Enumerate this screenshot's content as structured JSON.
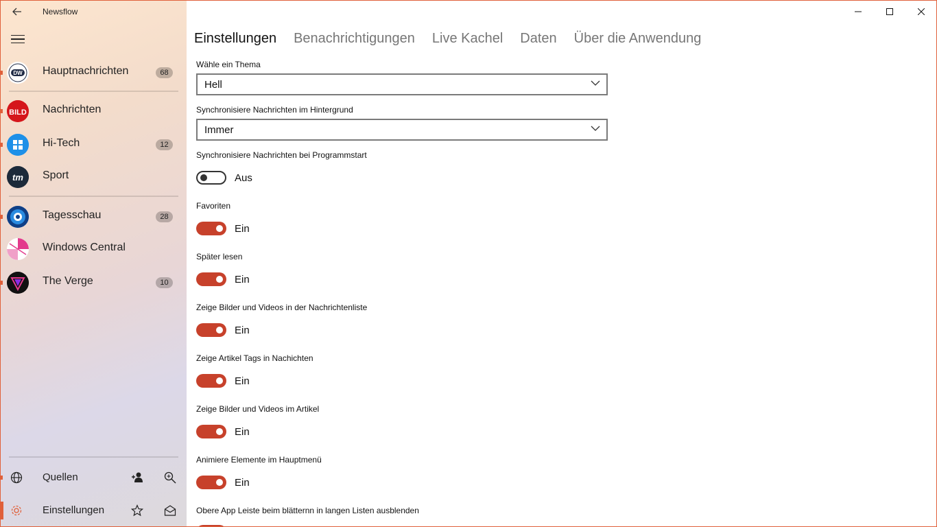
{
  "window": {
    "title": "Newsflow"
  },
  "sidebar": {
    "feeds": [
      {
        "label": "Hauptnachrichten",
        "badge": "68",
        "icon": "dw-logo-icon",
        "icon_text": "DW",
        "color": "#1f1f1f"
      },
      {
        "label": "Nachrichten",
        "badge": "",
        "icon": "bild-logo-icon",
        "icon_text": "BILD",
        "color": "#d5161b"
      },
      {
        "label": "Hi-Tech",
        "badge": "12",
        "icon": "hitech-logo-icon",
        "icon_text": "",
        "color": "#1e90e8"
      },
      {
        "label": "Sport",
        "badge": "",
        "icon": "tm-logo-icon",
        "icon_text": "tm",
        "color": "#1c2a3a"
      },
      {
        "label": "Tagesschau",
        "badge": "28",
        "icon": "tagesschau-logo-icon",
        "icon_text": "",
        "color": "#1a5fb4"
      },
      {
        "label": "Windows Central",
        "badge": "",
        "icon": "windows-central-logo-icon",
        "icon_text": "",
        "color": "#e33a8c"
      },
      {
        "label": "The Verge",
        "badge": "10",
        "icon": "the-verge-logo-icon",
        "icon_text": "",
        "color": "#111111"
      }
    ],
    "bottom": {
      "sources_label": "Quellen",
      "settings_label": "Einstellungen"
    }
  },
  "tabs": [
    {
      "label": "Einstellungen",
      "active": true
    },
    {
      "label": "Benachrichtigungen",
      "active": false
    },
    {
      "label": "Live Kachel",
      "active": false
    },
    {
      "label": "Daten",
      "active": false
    },
    {
      "label": "Über die Anwendung",
      "active": false
    }
  ],
  "settings": {
    "theme": {
      "label": "Wähle ein Thema",
      "value": "Hell"
    },
    "sync_background": {
      "label": "Synchronisiere Nachrichten im Hintergrund",
      "value": "Immer"
    },
    "sync_start": {
      "label": "Synchronisiere Nachrichten bei Programmstart",
      "state": "Aus"
    },
    "favorites": {
      "label": "Favoriten",
      "state": "Ein"
    },
    "read_later": {
      "label": "Später lesen",
      "state": "Ein"
    },
    "media_list": {
      "label": "Zeige Bilder und Videos in der Nachrichtenliste",
      "state": "Ein"
    },
    "article_tags": {
      "label": "Zeige Artikel Tags in Nachichten",
      "state": "Ein"
    },
    "media_article": {
      "label": "Zeige Bilder und Videos im Artikel",
      "state": "Ein"
    },
    "animate": {
      "label": "Animiere Elemente im Hauptmenü",
      "state": "Ein"
    },
    "hide_bar": {
      "label": "Obere App Leiste beim blätternn in langen Listen ausblenden"
    }
  },
  "colors": {
    "accent": "#c7412b",
    "border": "#e0603a"
  }
}
